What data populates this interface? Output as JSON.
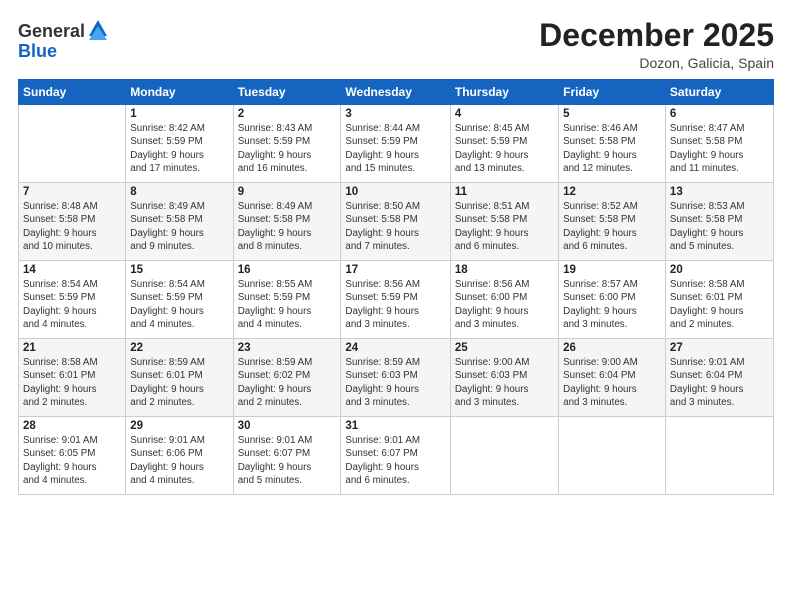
{
  "header": {
    "logo": {
      "general": "General",
      "blue": "Blue"
    },
    "month": "December 2025",
    "location": "Dozon, Galicia, Spain"
  },
  "weekdays": [
    "Sunday",
    "Monday",
    "Tuesday",
    "Wednesday",
    "Thursday",
    "Friday",
    "Saturday"
  ],
  "weeks": [
    [
      {
        "num": "",
        "info": ""
      },
      {
        "num": "1",
        "info": "Sunrise: 8:42 AM\nSunset: 5:59 PM\nDaylight: 9 hours\nand 17 minutes."
      },
      {
        "num": "2",
        "info": "Sunrise: 8:43 AM\nSunset: 5:59 PM\nDaylight: 9 hours\nand 16 minutes."
      },
      {
        "num": "3",
        "info": "Sunrise: 8:44 AM\nSunset: 5:59 PM\nDaylight: 9 hours\nand 15 minutes."
      },
      {
        "num": "4",
        "info": "Sunrise: 8:45 AM\nSunset: 5:59 PM\nDaylight: 9 hours\nand 13 minutes."
      },
      {
        "num": "5",
        "info": "Sunrise: 8:46 AM\nSunset: 5:58 PM\nDaylight: 9 hours\nand 12 minutes."
      },
      {
        "num": "6",
        "info": "Sunrise: 8:47 AM\nSunset: 5:58 PM\nDaylight: 9 hours\nand 11 minutes."
      }
    ],
    [
      {
        "num": "7",
        "info": "Sunrise: 8:48 AM\nSunset: 5:58 PM\nDaylight: 9 hours\nand 10 minutes."
      },
      {
        "num": "8",
        "info": "Sunrise: 8:49 AM\nSunset: 5:58 PM\nDaylight: 9 hours\nand 9 minutes."
      },
      {
        "num": "9",
        "info": "Sunrise: 8:49 AM\nSunset: 5:58 PM\nDaylight: 9 hours\nand 8 minutes."
      },
      {
        "num": "10",
        "info": "Sunrise: 8:50 AM\nSunset: 5:58 PM\nDaylight: 9 hours\nand 7 minutes."
      },
      {
        "num": "11",
        "info": "Sunrise: 8:51 AM\nSunset: 5:58 PM\nDaylight: 9 hours\nand 6 minutes."
      },
      {
        "num": "12",
        "info": "Sunrise: 8:52 AM\nSunset: 5:58 PM\nDaylight: 9 hours\nand 6 minutes."
      },
      {
        "num": "13",
        "info": "Sunrise: 8:53 AM\nSunset: 5:58 PM\nDaylight: 9 hours\nand 5 minutes."
      }
    ],
    [
      {
        "num": "14",
        "info": "Sunrise: 8:54 AM\nSunset: 5:59 PM\nDaylight: 9 hours\nand 4 minutes."
      },
      {
        "num": "15",
        "info": "Sunrise: 8:54 AM\nSunset: 5:59 PM\nDaylight: 9 hours\nand 4 minutes."
      },
      {
        "num": "16",
        "info": "Sunrise: 8:55 AM\nSunset: 5:59 PM\nDaylight: 9 hours\nand 4 minutes."
      },
      {
        "num": "17",
        "info": "Sunrise: 8:56 AM\nSunset: 5:59 PM\nDaylight: 9 hours\nand 3 minutes."
      },
      {
        "num": "18",
        "info": "Sunrise: 8:56 AM\nSunset: 6:00 PM\nDaylight: 9 hours\nand 3 minutes."
      },
      {
        "num": "19",
        "info": "Sunrise: 8:57 AM\nSunset: 6:00 PM\nDaylight: 9 hours\nand 3 minutes."
      },
      {
        "num": "20",
        "info": "Sunrise: 8:58 AM\nSunset: 6:01 PM\nDaylight: 9 hours\nand 2 minutes."
      }
    ],
    [
      {
        "num": "21",
        "info": "Sunrise: 8:58 AM\nSunset: 6:01 PM\nDaylight: 9 hours\nand 2 minutes."
      },
      {
        "num": "22",
        "info": "Sunrise: 8:59 AM\nSunset: 6:01 PM\nDaylight: 9 hours\nand 2 minutes."
      },
      {
        "num": "23",
        "info": "Sunrise: 8:59 AM\nSunset: 6:02 PM\nDaylight: 9 hours\nand 2 minutes."
      },
      {
        "num": "24",
        "info": "Sunrise: 8:59 AM\nSunset: 6:03 PM\nDaylight: 9 hours\nand 3 minutes."
      },
      {
        "num": "25",
        "info": "Sunrise: 9:00 AM\nSunset: 6:03 PM\nDaylight: 9 hours\nand 3 minutes."
      },
      {
        "num": "26",
        "info": "Sunrise: 9:00 AM\nSunset: 6:04 PM\nDaylight: 9 hours\nand 3 minutes."
      },
      {
        "num": "27",
        "info": "Sunrise: 9:01 AM\nSunset: 6:04 PM\nDaylight: 9 hours\nand 3 minutes."
      }
    ],
    [
      {
        "num": "28",
        "info": "Sunrise: 9:01 AM\nSunset: 6:05 PM\nDaylight: 9 hours\nand 4 minutes."
      },
      {
        "num": "29",
        "info": "Sunrise: 9:01 AM\nSunset: 6:06 PM\nDaylight: 9 hours\nand 4 minutes."
      },
      {
        "num": "30",
        "info": "Sunrise: 9:01 AM\nSunset: 6:07 PM\nDaylight: 9 hours\nand 5 minutes."
      },
      {
        "num": "31",
        "info": "Sunrise: 9:01 AM\nSunset: 6:07 PM\nDaylight: 9 hours\nand 6 minutes."
      },
      {
        "num": "",
        "info": ""
      },
      {
        "num": "",
        "info": ""
      },
      {
        "num": "",
        "info": ""
      }
    ]
  ]
}
